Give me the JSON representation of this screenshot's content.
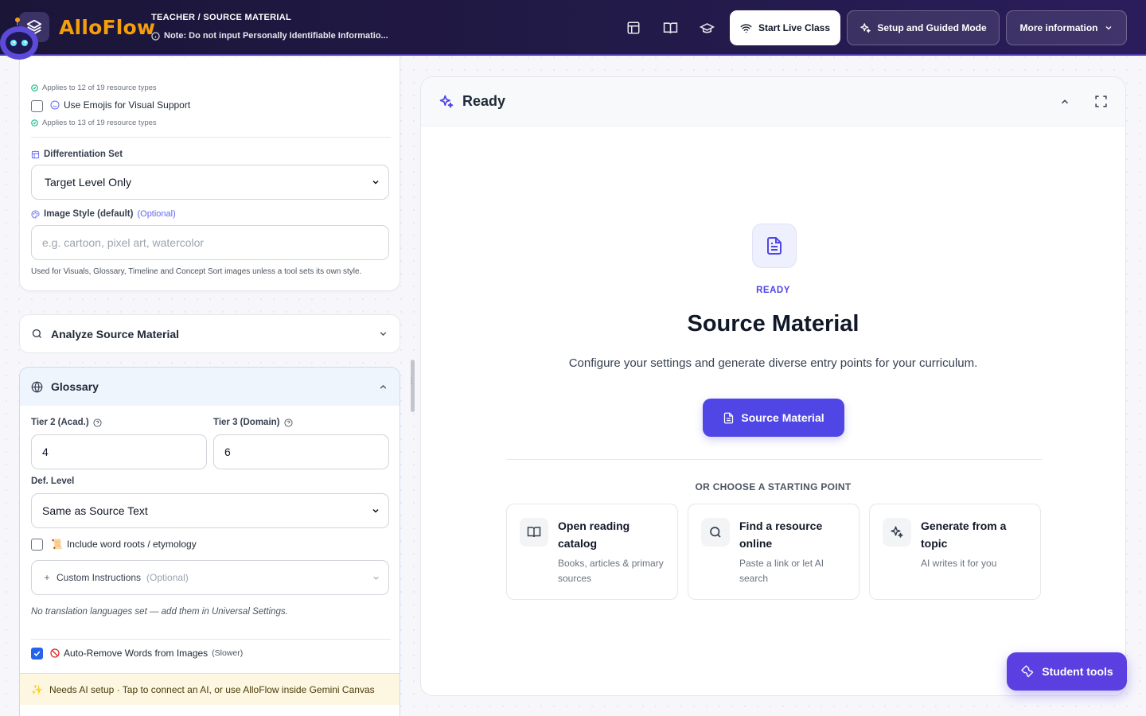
{
  "app": {
    "brand": "AlloFlow",
    "breadcrumb": "TEACHER / SOURCE MATERIAL",
    "note": "Note: Do not input Personally Identifiable Informatio...",
    "start_live": "Start Live Class",
    "setup_guided": "Setup and Guided Mode",
    "more_info": "More information"
  },
  "left": {
    "applies_top": "Applies to 12 of 19 resource types",
    "emoji_label": "Use Emojis for Visual Support",
    "emoji_checked": false,
    "applies_emoji": "Applies to 13 of 19 resource types",
    "diff_label": "Differentiation Set",
    "diff_value": "Target Level Only",
    "img_style_label": "Image Style (default)",
    "img_style_optional": "(Optional)",
    "img_style_placeholder": "e.g. cartoon, pixel art, watercolor",
    "img_style_help": "Used for Visuals, Glossary, Timeline and Concept Sort images unless a tool sets its own style.",
    "analyze_title": "Analyze Source Material",
    "glossary": {
      "title": "Glossary",
      "tier2_label": "Tier 2 (Acad.)",
      "tier2_value": "4",
      "tier3_label": "Tier 3 (Domain)",
      "tier3_value": "6",
      "def_label": "Def. Level",
      "def_value": "Same as Source Text",
      "roots_emoji": "📜",
      "roots_label": "Include word roots / etymology",
      "roots_checked": false,
      "custom_label": "Custom Instructions",
      "custom_optional": "(Optional)",
      "no_translation": "No translation languages set — add them in Universal Settings.",
      "auto_remove_label": "Auto-Remove Words from Images",
      "auto_remove_note": "(Slower)",
      "auto_remove_checked": true
    },
    "ai_setup_emoji": "✨",
    "ai_setup": "Needs AI setup · Tap to connect an AI, or use AlloFlow inside Gemini Canvas"
  },
  "right": {
    "status": "Ready",
    "tag": "READY",
    "title": "Source Material",
    "subtitle": "Configure your settings and generate diverse entry points for your curriculum.",
    "primary_button": "Source Material",
    "or_label": "OR CHOOSE A STARTING POINT",
    "options": [
      {
        "title": "Open reading catalog",
        "desc": "Books, articles & primary sources",
        "icon": "book-icon"
      },
      {
        "title": "Find a resource online",
        "desc": "Paste a link or let AI search",
        "icon": "search-icon"
      },
      {
        "title": "Generate from a topic",
        "desc": "AI writes it for you",
        "icon": "sparkles-icon"
      }
    ]
  },
  "student_tools": "Student tools",
  "colors": {
    "accent": "#4f46e5",
    "brand_orange": "#f59e0b",
    "header_dark": "#1b1538",
    "student_button": "#5b3fe0"
  }
}
